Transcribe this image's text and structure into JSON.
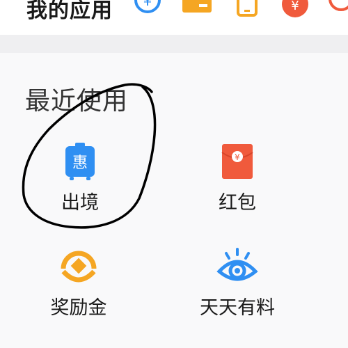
{
  "my_apps": {
    "title": "我的应用",
    "icons": [
      {
        "name": "yuan-exchange-icon",
        "glyph": "¥"
      },
      {
        "name": "card-icon"
      },
      {
        "name": "phone-icon"
      },
      {
        "name": "money-bag-icon",
        "glyph": "¥"
      },
      {
        "name": "red-circle-icon"
      }
    ]
  },
  "recent": {
    "title": "最近使用",
    "apps": [
      {
        "label": "出境",
        "icon": "luggage-icon",
        "glyph": "惠",
        "color": "#2f8ff2"
      },
      {
        "label": "红包",
        "icon": "red-envelope-icon",
        "glyph": "¥",
        "color": "#f05a3c"
      },
      {
        "label": "奖励金",
        "icon": "reward-coin-icon",
        "color": "#f5a623"
      },
      {
        "label": "天天有料",
        "icon": "eye-icon",
        "color": "#2f8ff2"
      }
    ]
  },
  "colors": {
    "accent_blue": "#2f8ff2",
    "accent_red": "#f05a3c",
    "accent_orange": "#f5a623",
    "annotation": "#000000"
  }
}
